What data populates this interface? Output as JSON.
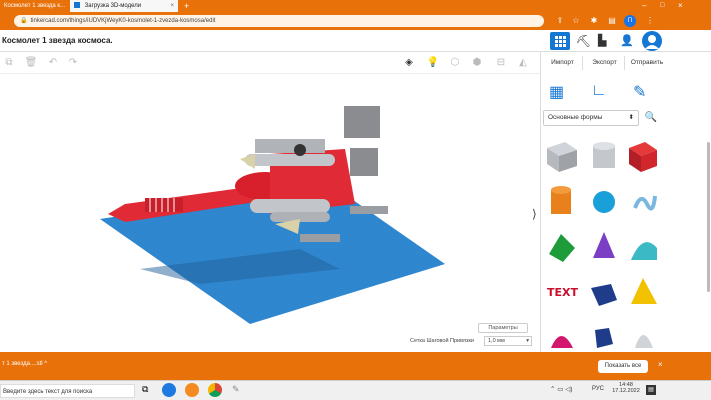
{
  "browser": {
    "tabs": [
      {
        "label": "Космолет 1 звезда к..."
      },
      {
        "label": "Загрузка 3D-модели"
      }
    ],
    "url": "tinkercad.com/things/iUDVKjWeyK0-kosmolet-1-zvezda-kosmosa/edit"
  },
  "app": {
    "title": "Космолет 1 звезда космоса.",
    "panel": {
      "import_label": "Импорт",
      "export_label": "Экспорт",
      "send_label": "Отправить",
      "category": "Основные формы"
    }
  },
  "workplane": {
    "params_label": "Параметры",
    "grid_label": "Сетка Шаговой Привязки",
    "grid_value": "1,0 мм"
  },
  "downloads": {
    "item": "т 1 звезда....stl",
    "show_all": "Показать все"
  },
  "taskbar": {
    "search_placeholder": "Введите здесь текст для поиска",
    "lang": "РУС",
    "time": "14:48",
    "date": "17.12.2022"
  }
}
